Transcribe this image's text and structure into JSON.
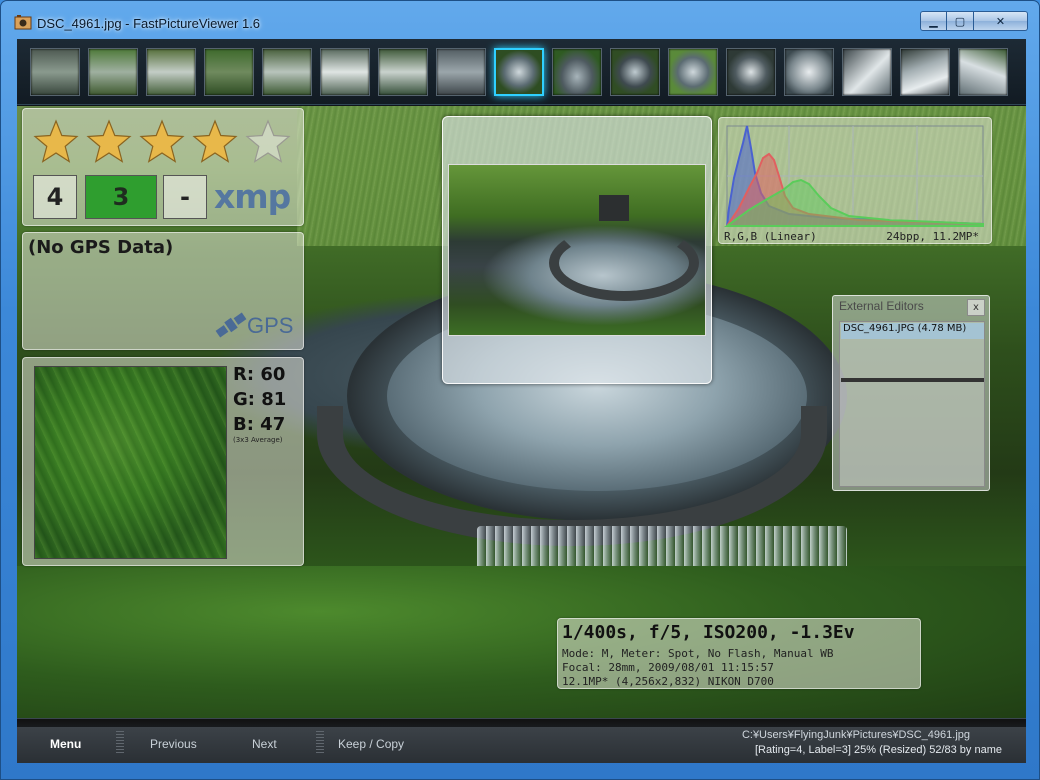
{
  "window": {
    "title": "DSC_4961.jpg - FastPictureViewer 1.6",
    "minimize_label": "▁",
    "maximize_label": "▢",
    "close_label": "✕"
  },
  "thumbnails": {
    "count": 17,
    "selected_index": 8
  },
  "rating": {
    "stars_filled": 4,
    "stars_total": 5,
    "rating_value": "4",
    "label_value": "3",
    "clear_label": "-",
    "xmp_label": "xmp",
    "label_color": "#2f9e2f"
  },
  "gps": {
    "title": "(No GPS Data)",
    "logo_text": "GPS"
  },
  "color_probe": {
    "r": "R: 60",
    "g": "G: 81",
    "b": "B: 47",
    "note": "(3x3 Average)"
  },
  "histogram": {
    "channels_label": "R,G,B (Linear)",
    "info_label": "24bpp, 11.2MP*"
  },
  "external_editors": {
    "title": "External Editors",
    "close_label": "x",
    "items": [
      "DSC_4961.JPG (4.78 MB)"
    ]
  },
  "exif": {
    "main": "1/400s, f/5, ISO200, -1.3Ev",
    "line1": "Mode: M, Meter: Spot, No Flash, Manual WB",
    "line2": "Focal: 28mm, 2009/08/01 11:15:57",
    "line3": "12.1MP* (4,256x2,832) NIKON D700"
  },
  "toolbar": {
    "menu": "Menu",
    "previous": "Previous",
    "next": "Next",
    "keep_copy": "Keep / Copy"
  },
  "status": {
    "path": "C:¥Users¥FlyingJunk¥Pictures¥DSC_4961.jpg",
    "info": "[Rating=4, Label=3] 25% (Resized) 52/83  by name"
  },
  "colors": {
    "accent_selected": "#2fd0ff",
    "hist_red": "#e06060",
    "hist_green": "#5acc5a",
    "hist_blue": "#4a62d0"
  }
}
